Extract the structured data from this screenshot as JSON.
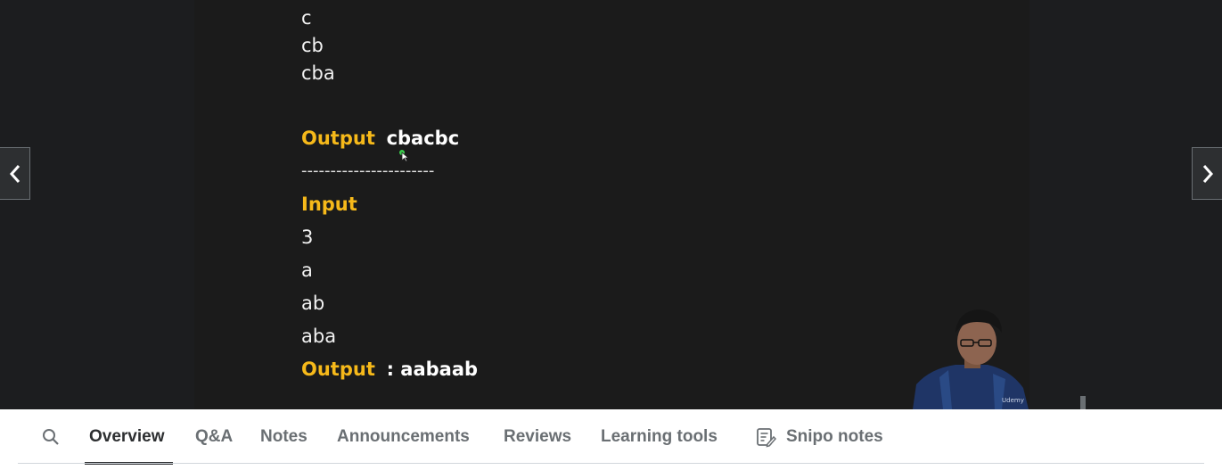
{
  "slide": {
    "lines_top": [
      "c",
      "cb",
      "cba"
    ],
    "output1_label": "Output",
    "output1_value": "cbacbc",
    "separator": "-----------------------",
    "input_label": "Input",
    "input_lines": [
      "3",
      "a",
      "ab",
      "aba"
    ],
    "output2_label": "Output",
    "output2_value": ": aabaab"
  },
  "presenter": {
    "watermark": "Udemy"
  },
  "tabs": {
    "overview": "Overview",
    "qa": "Q&A",
    "notes": "Notes",
    "announcements": "Announcements",
    "reviews": "Reviews",
    "learning_tools": "Learning tools",
    "snipo_notes": "Snipo notes"
  },
  "icons": {
    "search": "search-icon",
    "prev": "chevron-left-icon",
    "next": "chevron-right-icon",
    "snipo": "notes-icon"
  },
  "colors": {
    "accent": "#f6b91a",
    "video_bg": "#1c1d1f",
    "tab_active": "#2d2f31",
    "tab_inactive": "#6a6f73"
  }
}
